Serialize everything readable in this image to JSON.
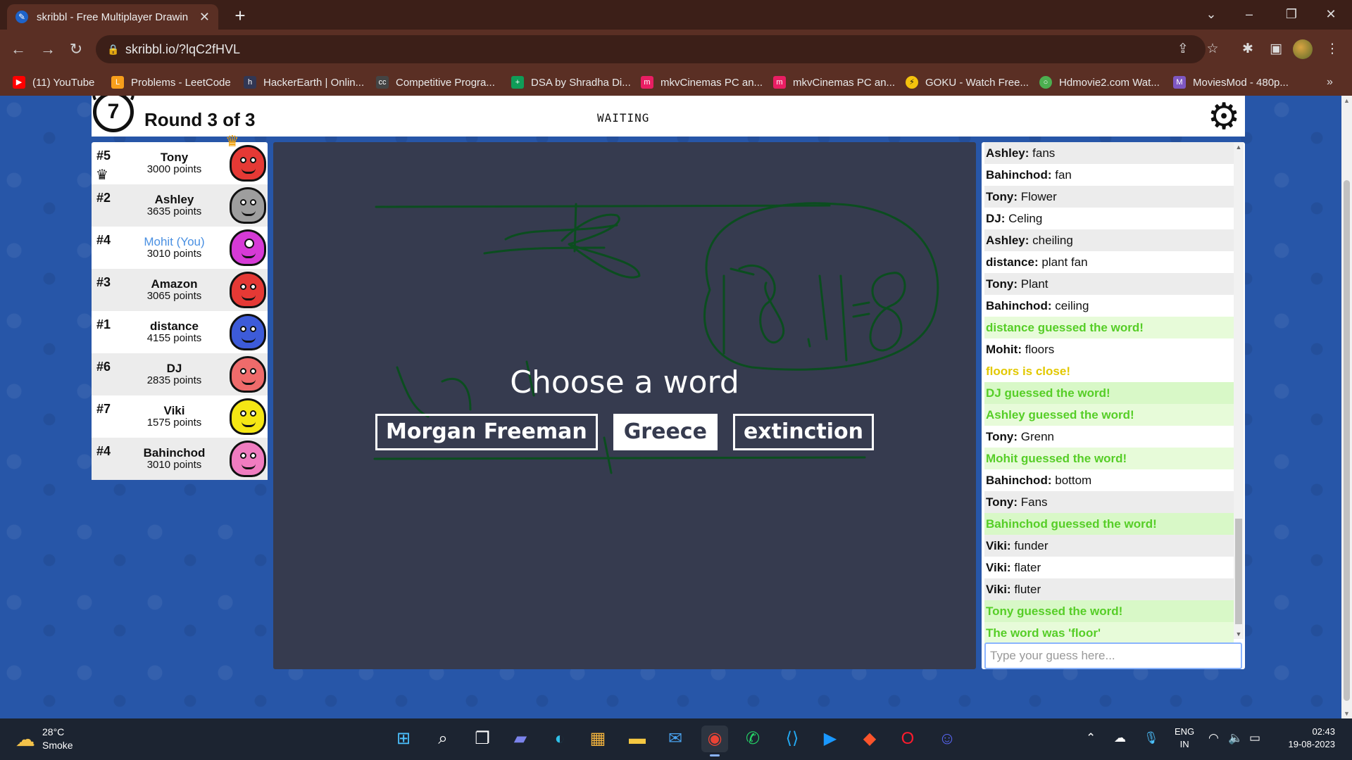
{
  "browser": {
    "tab_title": "skribbl - Free Multiplayer Drawin",
    "url": "skribbl.io/?lqC2fHVL",
    "bookmarks": [
      {
        "label": "(11) YouTube",
        "icon": "youtube-icon",
        "color": "#ff0000"
      },
      {
        "label": "Problems - LeetCode",
        "icon": "leetcode-icon",
        "color": "#f89f1b"
      },
      {
        "label": "HackerEarth | Onlin...",
        "icon": "hackerearth-icon",
        "color": "#323754"
      },
      {
        "label": "Competitive Progra...",
        "icon": "cc-icon",
        "color": "#444444"
      },
      {
        "label": "DSA by Shradha Di...",
        "icon": "sheets-icon",
        "color": "#0f9d58"
      },
      {
        "label": "mkvCinemas PC an...",
        "icon": "mkv-icon",
        "color": "#e91e63"
      },
      {
        "label": "mkvCinemas PC an...",
        "icon": "mkv-icon",
        "color": "#e91e63"
      },
      {
        "label": "GOKU - Watch Free...",
        "icon": "goku-icon",
        "color": "#f4c20d"
      },
      {
        "label": "Hdmovie2.com Wat...",
        "icon": "hdmovie-icon",
        "color": "#4caf50"
      },
      {
        "label": "MoviesMod - 480p...",
        "icon": "moviesmod-icon",
        "color": "#7e57c2"
      }
    ]
  },
  "game": {
    "timer": "7",
    "round": "Round 3 of 3",
    "status": "WAITING",
    "choose_prompt": "Choose a word",
    "words": [
      "Morgan Freeman",
      "Greece",
      "extinction"
    ],
    "selected_word_index": 1,
    "canvas_bg": "#363b4f",
    "drawing_color": "#0b4d1f"
  },
  "players": [
    {
      "rank": "#5",
      "name": "Tony",
      "points": "3000 points",
      "color": "#e53935",
      "crown": true,
      "drawer": true
    },
    {
      "rank": "#2",
      "name": "Ashley",
      "points": "3635 points",
      "color": "#9e9e9e"
    },
    {
      "rank": "#4",
      "name": "Mohit (You)",
      "points": "3010 points",
      "color": "#d63ad6",
      "you": true
    },
    {
      "rank": "#3",
      "name": "Amazon",
      "points": "3065 points",
      "color": "#e53935"
    },
    {
      "rank": "#1",
      "name": "distance",
      "points": "4155 points",
      "color": "#3d5bd9"
    },
    {
      "rank": "#6",
      "name": "DJ",
      "points": "2835 points",
      "color": "#ef6b6b"
    },
    {
      "rank": "#7",
      "name": "Viki",
      "points": "1575 points",
      "color": "#f5e614"
    },
    {
      "rank": "#4",
      "name": "Bahinchod",
      "points": "3010 points",
      "color": "#f07cc0"
    }
  ],
  "chat": [
    {
      "user": "Ashley:",
      "text": "fans",
      "type": "normal"
    },
    {
      "user": "Bahinchod:",
      "text": "fan",
      "type": "normal"
    },
    {
      "user": "Tony:",
      "text": "Flower",
      "type": "normal"
    },
    {
      "user": "DJ:",
      "text": "Celing",
      "type": "normal"
    },
    {
      "user": "Ashley:",
      "text": "cheiling",
      "type": "normal"
    },
    {
      "user": "distance:",
      "text": "plant fan",
      "type": "normal"
    },
    {
      "user": "Tony:",
      "text": "Plant",
      "type": "normal"
    },
    {
      "user": "Bahinchod:",
      "text": "ceiling",
      "type": "normal"
    },
    {
      "user": "",
      "text": "distance guessed the word!",
      "type": "good"
    },
    {
      "user": "Mohit:",
      "text": "floors",
      "type": "normal"
    },
    {
      "user": "",
      "text": "floors is close!",
      "type": "close"
    },
    {
      "user": "",
      "text": "DJ guessed the word!",
      "type": "good"
    },
    {
      "user": "",
      "text": "Ashley guessed the word!",
      "type": "good"
    },
    {
      "user": "Tony:",
      "text": "Grenn",
      "type": "normal"
    },
    {
      "user": "",
      "text": "Mohit guessed the word!",
      "type": "good"
    },
    {
      "user": "Bahinchod:",
      "text": "bottom",
      "type": "normal"
    },
    {
      "user": "Tony:",
      "text": "Fans",
      "type": "normal"
    },
    {
      "user": "",
      "text": "Bahinchod guessed the word!",
      "type": "good"
    },
    {
      "user": "Viki:",
      "text": "funder",
      "type": "normal"
    },
    {
      "user": "Viki:",
      "text": "flater",
      "type": "normal"
    },
    {
      "user": "Viki:",
      "text": "fluter",
      "type": "normal"
    },
    {
      "user": "",
      "text": "Tony guessed the word!",
      "type": "good"
    },
    {
      "user": "",
      "text": "The word was 'floor'",
      "type": "good"
    }
  ],
  "guess_placeholder": "Type your guess here...",
  "taskbar": {
    "temperature": "28°C",
    "weather": "Smoke",
    "lang_top": "ENG",
    "lang_bottom": "IN",
    "time": "02:43",
    "date": "19-08-2023",
    "apps": [
      "windows-start-icon",
      "search-icon",
      "task-view-icon",
      "teams-icon",
      "edge-icon",
      "store-icon",
      "file-explorer-icon",
      "mail-icon",
      "chrome-icon",
      "whatsapp-icon",
      "vscode-icon",
      "prime-video-icon",
      "brave-icon",
      "opera-icon",
      "discord-icon"
    ]
  }
}
